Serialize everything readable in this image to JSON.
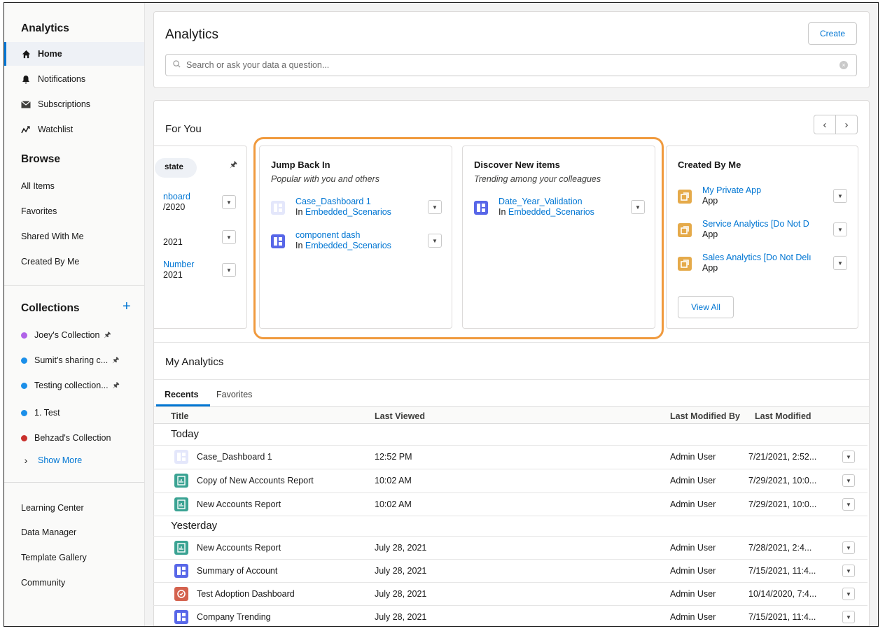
{
  "sidebar": {
    "analytics_title": "Analytics",
    "nav": [
      {
        "label": "Home",
        "icon": "home-icon"
      },
      {
        "label": "Notifications",
        "icon": "bell-icon"
      },
      {
        "label": "Subscriptions",
        "icon": "envelope-icon"
      },
      {
        "label": "Watchlist",
        "icon": "trend-icon"
      }
    ],
    "browse_title": "Browse",
    "browse": [
      "All Items",
      "Favorites",
      "Shared With Me",
      "Created By Me"
    ],
    "collections_title": "Collections",
    "collections": [
      {
        "label": "Joey's Collection",
        "color": "#b063e8",
        "pinned": true
      },
      {
        "label": "Sumit's sharing c...",
        "color": "#1b8fe9",
        "pinned": true
      },
      {
        "label": "Testing collection...",
        "color": "#1b8fe9",
        "pinned": true
      },
      {
        "label": "1. Test",
        "color": "#1b8fe9",
        "pinned": false
      },
      {
        "label": "Behzad's Collection",
        "color": "#c9302c",
        "pinned": false
      }
    ],
    "show_more": "Show More",
    "footer": [
      "Learning Center",
      "Data Manager",
      "Template Gallery",
      "Community"
    ]
  },
  "header": {
    "title": "Analytics",
    "create_label": "Create",
    "search_placeholder": "Search or ask your data a question..."
  },
  "for_you": {
    "title": "For You",
    "partial_card": {
      "chip": "state",
      "lines": [
        "nboard",
        "/2020",
        "2021",
        "Number",
        "2021"
      ]
    },
    "jump_back_in": {
      "title": "Jump Back In",
      "subtitle": "Popular with you and others",
      "items": [
        {
          "name": "Case_Dashboard 1",
          "in_label": "In",
          "app": "Embedded_Scenarios"
        },
        {
          "name": "component dash",
          "in_label": "In",
          "app": "Embedded_Scenarios"
        }
      ]
    },
    "discover": {
      "title": "Discover New items",
      "subtitle": "Trending among your colleagues",
      "items": [
        {
          "name": "Date_Year_Validation",
          "in_label": "In",
          "app": "Embedded_Scenarios"
        }
      ]
    },
    "created_by_me": {
      "title": "Created By Me",
      "items": [
        {
          "name": "My Private App",
          "type": "App"
        },
        {
          "name": "Service Analytics [Do Not D",
          "type": "App"
        },
        {
          "name": "Sales Analytics [Do Not Delı",
          "type": "App"
        }
      ],
      "view_all": "View All"
    }
  },
  "my_analytics": {
    "title": "My Analytics",
    "tabs": [
      "Recents",
      "Favorites"
    ],
    "columns": [
      "Title",
      "Last Viewed",
      "Last Modified By",
      "Last Modified"
    ],
    "groups": [
      {
        "label": "Today",
        "rows": [
          {
            "title": "Case_Dashboard 1",
            "icon": "dashboard-light-icon",
            "viewed": "12:52 PM",
            "by": "Admin User",
            "modified": "7/21/2021, 2:52..."
          },
          {
            "title": "Copy of New Accounts Report",
            "icon": "report-icon",
            "viewed": "10:02 AM",
            "by": "Admin User",
            "modified": "7/29/2021, 10:0..."
          },
          {
            "title": "New Accounts Report",
            "icon": "report-icon",
            "viewed": "10:02 AM",
            "by": "Admin User",
            "modified": "7/29/2021, 10:0..."
          }
        ]
      },
      {
        "label": "Yesterday",
        "rows": [
          {
            "title": "New Accounts Report",
            "icon": "report-icon",
            "viewed": "July 28, 2021",
            "by": "Admin User",
            "modified": "7/28/2021, 2:4..."
          },
          {
            "title": "Summary of Account",
            "icon": "dashboard-icon",
            "viewed": "July 28, 2021",
            "by": "Admin User",
            "modified": "7/15/2021, 11:4..."
          },
          {
            "title": "Test Adoption Dashboard",
            "icon": "adoption-icon",
            "viewed": "July 28, 2021",
            "by": "Admin User",
            "modified": "10/14/2020, 7:4..."
          },
          {
            "title": "Company Trending",
            "icon": "dashboard-icon",
            "viewed": "July 28, 2021",
            "by": "Admin User",
            "modified": "7/15/2021, 11:4..."
          }
        ]
      }
    ]
  },
  "colors": {
    "accent": "#0176d3",
    "highlight": "#f09a3e",
    "dashboard": "#5867e8",
    "report": "#3ba393",
    "app": "#e5aa4a",
    "adoption": "#d4624e"
  }
}
